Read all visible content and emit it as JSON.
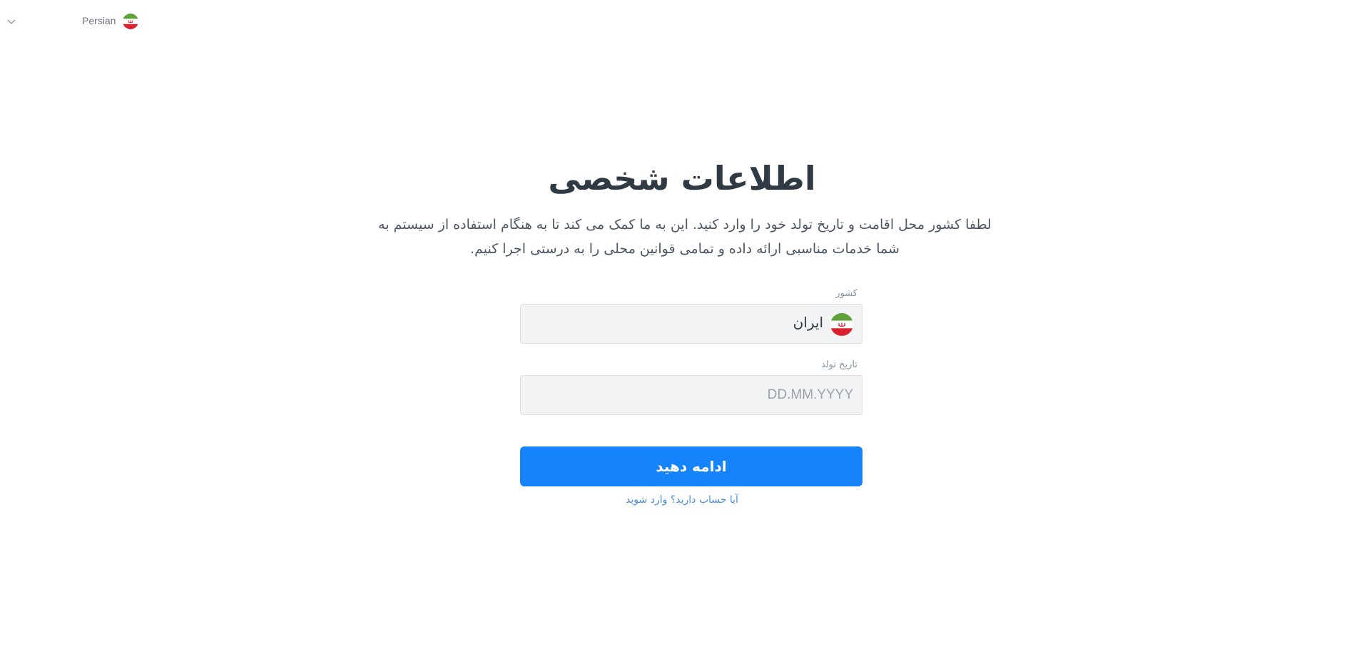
{
  "header": {
    "language_label": "Persian",
    "language_flag_icon": "iran-flag-icon",
    "chevron_icon": "chevron-down-icon"
  },
  "main": {
    "title": "اطلاعات شخصی",
    "subtitle": "لطفا کشور محل اقامت و تاریخ تولد خود را وارد کنید. این به ما کمک می کند تا به هنگام استفاده از سیستم به شما خدمات مناسبی ارائه داده و تمامی قوانین محلی را به درستی اجرا کنیم.",
    "country": {
      "label": "کشور",
      "value": "ایران",
      "flag_icon": "iran-flag-icon"
    },
    "birthdate": {
      "label": "تاریخ تولد",
      "value": "",
      "placeholder": "DD.MM.YYYY"
    },
    "continue_label": "ادامه دهید",
    "login_link": "آیا حساب دارید؟ وارد شوید"
  },
  "colors": {
    "primary": "#1583fb",
    "title": "#2f3a45",
    "link": "#4a8fd8",
    "field_bg": "#f2f3f5"
  }
}
